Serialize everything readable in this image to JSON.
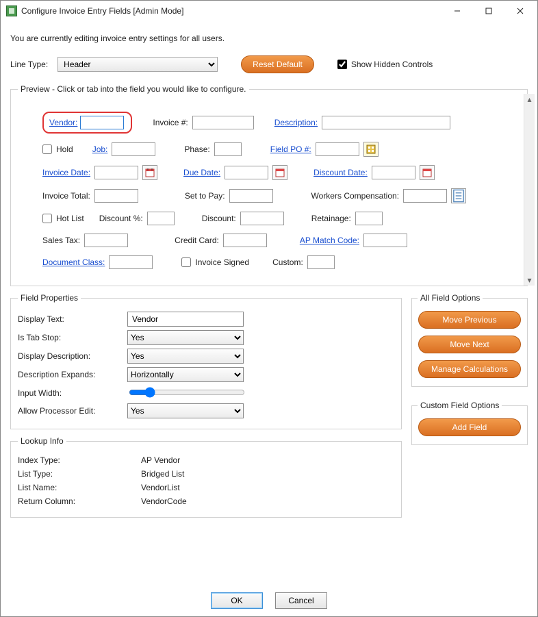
{
  "window": {
    "title": "Configure Invoice Entry Fields [Admin Mode]"
  },
  "intro": "You are currently editing invoice entry settings for all users.",
  "lineType": {
    "label": "Line Type:",
    "value": "Header"
  },
  "resetDefault": "Reset Default",
  "showHidden": {
    "label": "Show Hidden Controls",
    "checked": true
  },
  "preview": {
    "legend": "Preview - Click or tab into the field you would like to configure.",
    "labels": {
      "vendor": "Vendor:",
      "invoiceNum": "Invoice #:",
      "description": "Description:",
      "hold": "Hold",
      "job": "Job:",
      "phase": "Phase:",
      "fieldPO": "Field PO #:",
      "invoiceDate": "Invoice Date:",
      "dueDate": "Due Date:",
      "discountDate": "Discount Date:",
      "invoiceTotal": "Invoice Total:",
      "setToPay": "Set to Pay:",
      "workersComp": "Workers Compensation:",
      "hotList": "Hot List",
      "discountPct": "Discount %:",
      "discount": "Discount:",
      "retainage": "Retainage:",
      "salesTax": "Sales Tax:",
      "creditCard": "Credit Card:",
      "apMatchCode": "AP Match Code:",
      "documentClass": "Document Class:",
      "invoiceSigned": "Invoice Signed",
      "custom": "Custom:"
    }
  },
  "fieldProps": {
    "legend": "Field Properties",
    "displayText": {
      "label": "Display Text:",
      "value": "Vendor"
    },
    "isTabStop": {
      "label": "Is Tab Stop:",
      "value": "Yes"
    },
    "displayDesc": {
      "label": "Display Description:",
      "value": "Yes"
    },
    "descExpands": {
      "label": "Description Expands:",
      "value": "Horizontally"
    },
    "inputWidth": {
      "label": "Input Width:"
    },
    "allowProc": {
      "label": "Allow Processor Edit:",
      "value": "Yes"
    }
  },
  "lookup": {
    "legend": "Lookup Info",
    "indexType": {
      "label": "Index Type:",
      "value": "AP Vendor"
    },
    "listType": {
      "label": "List Type:",
      "value": "Bridged List"
    },
    "listName": {
      "label": "List Name:",
      "value": "VendorList"
    },
    "returnCol": {
      "label": "Return Column:",
      "value": "VendorCode"
    }
  },
  "allFieldOptions": {
    "legend": "All Field Options",
    "movePrev": "Move Previous",
    "moveNext": "Move Next",
    "manageCalc": "Manage Calculations"
  },
  "customFieldOptions": {
    "legend": "Custom Field Options",
    "addField": "Add Field"
  },
  "buttons": {
    "ok": "OK",
    "cancel": "Cancel"
  }
}
